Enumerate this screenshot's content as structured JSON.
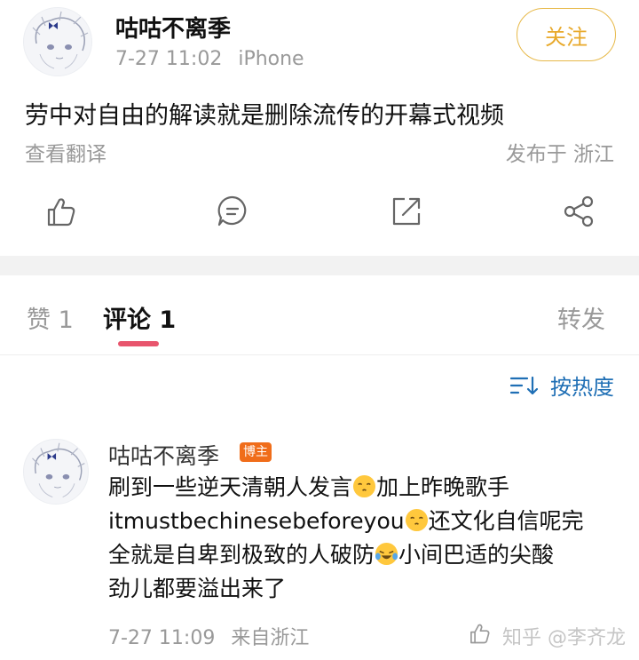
{
  "post": {
    "author": "咕咕不离季",
    "time": "7-27 11:02",
    "device": "iPhone",
    "follow_label": "关注",
    "content": "劳中对自由的解读就是删除流传的开幕式视频",
    "translate_label": "查看翻译",
    "location": "发布于 浙江"
  },
  "tabs": {
    "like": "赞 1",
    "comment": "评论 1",
    "repost": "转发"
  },
  "sort_label": "按热度",
  "comment": {
    "author": "咕咕不离季",
    "badge": "博主",
    "line1_a": "刷到一些逆天清朝人发言",
    "line1_b": "加上昨晚歌手",
    "line2_a": "itmustbechinesebeforeyou",
    "line2_b": "还文化自信呢完",
    "line3_a": "全就是自卑到极致的人破防",
    "line3_b": "小间巴适的尖酸",
    "line4": "劲儿都要溢出来了",
    "time": "7-27 11:09",
    "source": "来自浙江"
  },
  "watermark": "知乎 @李齐龙",
  "colors": {
    "follow": "#e8a92b",
    "tab_underline": "#e8556d",
    "sort": "#1f6fb5",
    "badge": "#f06d1a"
  }
}
